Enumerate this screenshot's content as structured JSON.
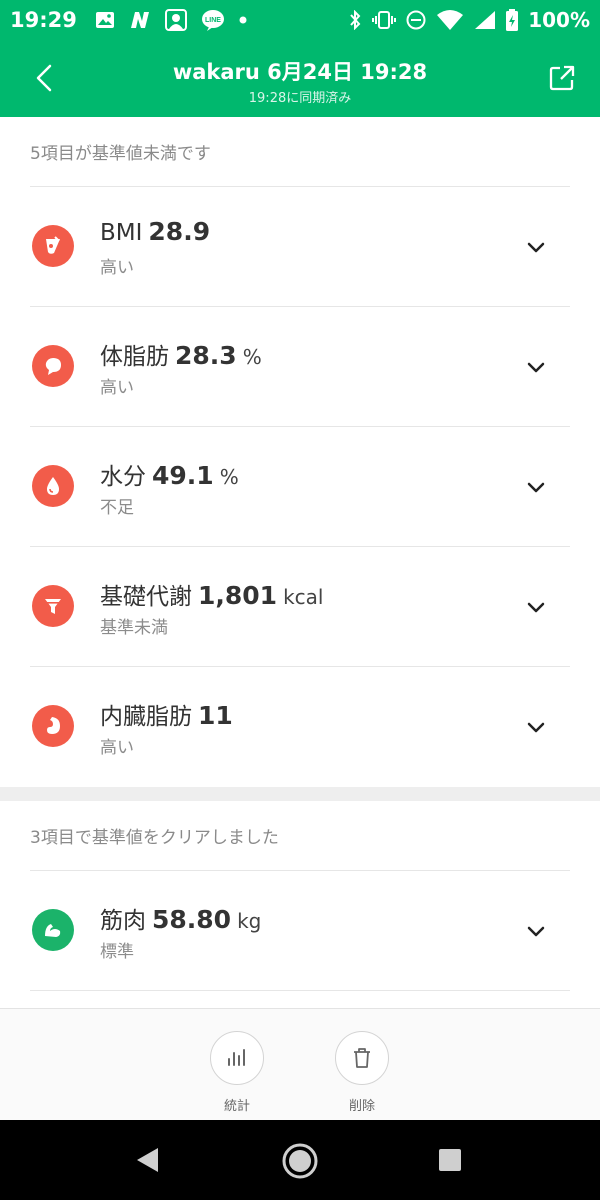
{
  "status_bar": {
    "time": "19:29",
    "battery": "100%",
    "left_icons": [
      "image-icon",
      "n-app-icon",
      "profile-app-icon",
      "line-app-icon",
      "dot-icon"
    ],
    "right_icons": [
      "bluetooth-icon",
      "vibrate-icon",
      "do-not-disturb-icon",
      "wifi-icon",
      "signal-icon",
      "battery-icon"
    ]
  },
  "header": {
    "title": "wakaru 6月24日 19:28",
    "subtitle": "19:28に同期済み",
    "back_icon": "back-arrow-icon",
    "share_icon": "share-icon"
  },
  "section_below": {
    "label": "5項目が基準値未満です",
    "items": [
      {
        "name": "BMI",
        "value": "28.9",
        "unit": "",
        "status": "高い",
        "icon": "bmi-icon",
        "color": "#f25c4a"
      },
      {
        "name": "体脂肪",
        "value": "28.3",
        "unit": "%",
        "status": "高い",
        "icon": "body-fat-icon",
        "color": "#f25c4a"
      },
      {
        "name": "水分",
        "value": "49.1",
        "unit": "%",
        "status": "不足",
        "icon": "water-drop-icon",
        "color": "#f25c4a"
      },
      {
        "name": "基礎代謝",
        "value": "1,801",
        "unit": "kcal",
        "status": "基準未満",
        "icon": "funnel-icon",
        "color": "#f25c4a"
      },
      {
        "name": "内臓脂肪",
        "value": "11",
        "unit": "",
        "status": "高い",
        "icon": "stomach-icon",
        "color": "#f25c4a"
      }
    ]
  },
  "section_clear": {
    "label": "3項目で基準値をクリアしました",
    "items": [
      {
        "name": "筋肉",
        "value": "58.80",
        "unit": "kg",
        "status": "標準",
        "icon": "muscle-icon",
        "color": "#1bb36a"
      }
    ]
  },
  "bottom_bar": {
    "stats_label": "統計",
    "delete_label": "削除"
  }
}
